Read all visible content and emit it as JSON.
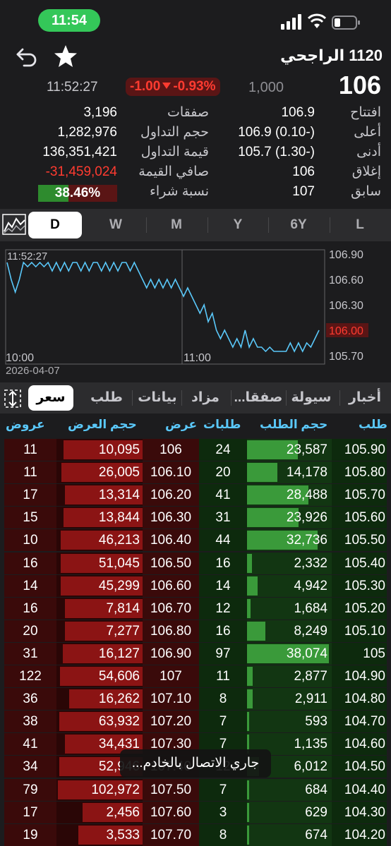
{
  "status": {
    "time": "11:54"
  },
  "header": {
    "stock_name": "1120 الراجحي",
    "last_price": "106",
    "volume_small": "1,000",
    "change": "-1.00",
    "change_pct": "-0.93%",
    "update_time": "11:52:27"
  },
  "stats_right": [
    {
      "label": "افتتاح",
      "value": "106.9"
    },
    {
      "label": "أعلى",
      "value": "106.9 (0.10-)"
    },
    {
      "label": "أدنى",
      "value": "105.7 (1.30-)"
    },
    {
      "label": "إغلاق",
      "value": "106"
    },
    {
      "label": "سابق",
      "value": "107"
    }
  ],
  "stats_left": [
    {
      "label": "صفقات",
      "value": "3,196"
    },
    {
      "label": "حجم التداول",
      "value": "1,282,976"
    },
    {
      "label": "قيمة التداول",
      "value": "136,351,421"
    },
    {
      "label": "صافي القيمة",
      "value": "-31,459,024"
    },
    {
      "label": "نسبة شراء",
      "value": "38.46%"
    }
  ],
  "buy_ratio": 0.3846,
  "periods": [
    "D",
    "W",
    "M",
    "Y",
    "6Y",
    "L"
  ],
  "active_period": "D",
  "chart_data": {
    "type": "line",
    "date": "2026-04-07",
    "time_label": "11:52:27",
    "x_ticks": [
      "10:00",
      "11:00"
    ],
    "y_ticks": [
      "106.90",
      "106.60",
      "106.30",
      "106.00",
      "105.70"
    ],
    "current_value_label": "106.00",
    "ylim": [
      105.6,
      106.95
    ],
    "values": [
      106.8,
      106.6,
      106.45,
      106.6,
      106.8,
      106.75,
      106.8,
      106.75,
      106.8,
      106.75,
      106.8,
      106.7,
      106.8,
      106.7,
      106.8,
      106.7,
      106.8,
      106.8,
      106.7,
      106.8,
      106.7,
      106.8,
      106.8,
      106.7,
      106.8,
      106.7,
      106.8,
      106.7,
      106.8,
      106.8,
      106.7,
      106.8,
      106.7,
      106.6,
      106.5,
      106.6,
      106.5,
      106.6,
      106.5,
      106.6,
      106.5,
      106.6,
      106.5,
      106.4,
      106.5,
      106.4,
      106.3,
      106.2,
      106.3,
      106.1,
      106.2,
      106.0,
      105.9,
      106.0,
      105.9,
      105.8,
      105.9,
      105.8,
      106.0,
      105.8,
      105.9,
      105.8,
      105.8,
      105.75,
      105.8,
      105.75,
      105.75,
      105.75,
      105.75,
      105.85,
      105.75,
      105.85,
      105.75,
      105.85,
      105.8,
      105.9,
      106.0
    ]
  },
  "tabs": [
    "أخبار",
    "سيولة",
    "صفقا...",
    "مزاد",
    "بيانات",
    "طلب",
    "سعر"
  ],
  "active_tab": "سعر",
  "depth_headers": {
    "asks": "عروض",
    "ask_vol": "حجم العرض",
    "ask_price": "عرض",
    "bid_count": "طلبات",
    "bid_vol": "حجم الطلب",
    "bid_price": "طلب"
  },
  "depth_rows": [
    {
      "asks": "11",
      "ask_vol": "10,095",
      "ask_price": "106",
      "bid_count": "24",
      "bid_vol": "23,587",
      "bid_price": "105.90",
      "ask_ratio": 0.92,
      "bid_ratio": 0.62
    },
    {
      "asks": "11",
      "ask_vol": "26,005",
      "ask_price": "106.10",
      "bid_count": "20",
      "bid_vol": "14,178",
      "bid_price": "105.80",
      "ask_ratio": 0.94,
      "bid_ratio": 0.37
    },
    {
      "asks": "17",
      "ask_vol": "13,314",
      "ask_price": "106.20",
      "bid_count": "41",
      "bid_vol": "28,488",
      "bid_price": "105.70",
      "ask_ratio": 0.9,
      "bid_ratio": 0.75
    },
    {
      "asks": "15",
      "ask_vol": "13,844",
      "ask_price": "106.30",
      "bid_count": "31",
      "bid_vol": "23,926",
      "bid_price": "105.60",
      "ask_ratio": 0.92,
      "bid_ratio": 0.63
    },
    {
      "asks": "10",
      "ask_vol": "46,213",
      "ask_price": "106.40",
      "bid_count": "44",
      "bid_vol": "32,736",
      "bid_price": "105.50",
      "ask_ratio": 0.95,
      "bid_ratio": 0.86
    },
    {
      "asks": "16",
      "ask_vol": "51,045",
      "ask_price": "106.50",
      "bid_count": "16",
      "bid_vol": "2,332",
      "bid_price": "105.40",
      "ask_ratio": 0.95,
      "bid_ratio": 0.06
    },
    {
      "asks": "14",
      "ask_vol": "45,299",
      "ask_price": "106.60",
      "bid_count": "14",
      "bid_vol": "4,942",
      "bid_price": "105.30",
      "ask_ratio": 0.95,
      "bid_ratio": 0.13
    },
    {
      "asks": "16",
      "ask_vol": "7,814",
      "ask_price": "106.70",
      "bid_count": "12",
      "bid_vol": "1,684",
      "bid_price": "105.20",
      "ask_ratio": 0.9,
      "bid_ratio": 0.04
    },
    {
      "asks": "20",
      "ask_vol": "7,277",
      "ask_price": "106.80",
      "bid_count": "16",
      "bid_vol": "8,249",
      "bid_price": "105.10",
      "ask_ratio": 0.9,
      "bid_ratio": 0.22
    },
    {
      "asks": "31",
      "ask_vol": "16,127",
      "ask_price": "106.90",
      "bid_count": "97",
      "bid_vol": "38,074",
      "bid_price": "105",
      "ask_ratio": 0.93,
      "bid_ratio": 1.0
    },
    {
      "asks": "122",
      "ask_vol": "54,606",
      "ask_price": "107",
      "bid_count": "11",
      "bid_vol": "2,877",
      "bid_price": "104.90",
      "ask_ratio": 0.96,
      "bid_ratio": 0.07
    },
    {
      "asks": "36",
      "ask_vol": "16,262",
      "ask_price": "107.10",
      "bid_count": "8",
      "bid_vol": "2,911",
      "bid_price": "104.80",
      "ask_ratio": 0.85,
      "bid_ratio": 0.07
    },
    {
      "asks": "38",
      "ask_vol": "63,932",
      "ask_price": "107.20",
      "bid_count": "7",
      "bid_vol": "593",
      "bid_price": "104.70",
      "ask_ratio": 0.97,
      "bid_ratio": 0.01
    },
    {
      "asks": "41",
      "ask_vol": "34,431",
      "ask_price": "107.30",
      "bid_count": "7",
      "bid_vol": "1,135",
      "bid_price": "104.60",
      "ask_ratio": 0.9,
      "bid_ratio": 0.02
    },
    {
      "asks": "34",
      "ask_vol": "52,946",
      "ask_price": "107.40",
      "bid_count": "12",
      "bid_vol": "6,012",
      "bid_price": "104.50",
      "ask_ratio": 0.97,
      "bid_ratio": 0.15
    },
    {
      "asks": "79",
      "ask_vol": "102,972",
      "ask_price": "107.50",
      "bid_count": "7",
      "bid_vol": "684",
      "bid_price": "104.40",
      "ask_ratio": 0.98,
      "bid_ratio": 0.01
    },
    {
      "asks": "17",
      "ask_vol": "2,456",
      "ask_price": "107.60",
      "bid_count": "3",
      "bid_vol": "629",
      "bid_price": "104.30",
      "ask_ratio": 0.7,
      "bid_ratio": 0.01
    },
    {
      "asks": "19",
      "ask_vol": "3,533",
      "ask_price": "107.70",
      "bid_count": "8",
      "bid_vol": "674",
      "bid_price": "104.20",
      "ask_ratio": 0.75,
      "bid_ratio": 0.01
    }
  ],
  "toast": "جاري الاتصال بالخادم...",
  "colors": {
    "up": "#34c759",
    "down": "#ff3b30",
    "accent": "#5ac8fa",
    "line": "#5ac8fa"
  }
}
